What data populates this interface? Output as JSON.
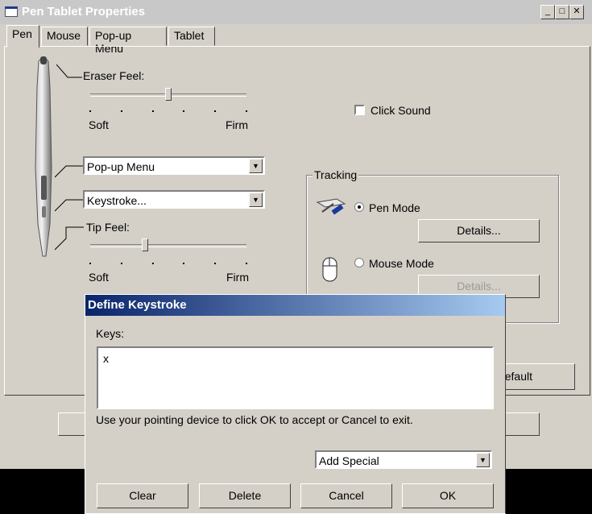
{
  "window": {
    "title": "Pen Tablet Properties"
  },
  "tabs": [
    {
      "label": "Pen"
    },
    {
      "label": "Mouse"
    },
    {
      "label": "Pop-up Menu"
    },
    {
      "label": "Tablet"
    }
  ],
  "pen": {
    "eraser_feel_label": "Eraser Feel:",
    "eraser_soft": "Soft",
    "eraser_firm": "Firm",
    "eraser_level": 0.5,
    "button_upper_value": "Pop-up Menu",
    "button_lower_value": "Keystroke...",
    "tip_feel_label": "Tip Feel:",
    "tip_soft": "Soft",
    "tip_firm": "Firm",
    "tip_level": 0.35,
    "click_sound_label": "Click Sound",
    "tracking_label": "Tracking",
    "pen_mode_label": "Pen Mode",
    "mouse_mode_label": "Mouse Mode",
    "details_label": "Details...",
    "details_disabled_label": "Details...",
    "default_partial": "efault"
  },
  "dialog": {
    "title": "Define Keystroke",
    "keys_label": "Keys:",
    "keys_value": "x",
    "hint": "Use your pointing device to click OK to accept or Cancel to exit.",
    "add_special": "Add Special",
    "buttons": {
      "clear": "Clear",
      "delete": "Delete",
      "cancel": "Cancel",
      "ok": "OK"
    }
  },
  "colors": {
    "face": "#d4d0c8",
    "dialog_title_start": "#0a246a",
    "dialog_title_end": "#a6caf0"
  }
}
